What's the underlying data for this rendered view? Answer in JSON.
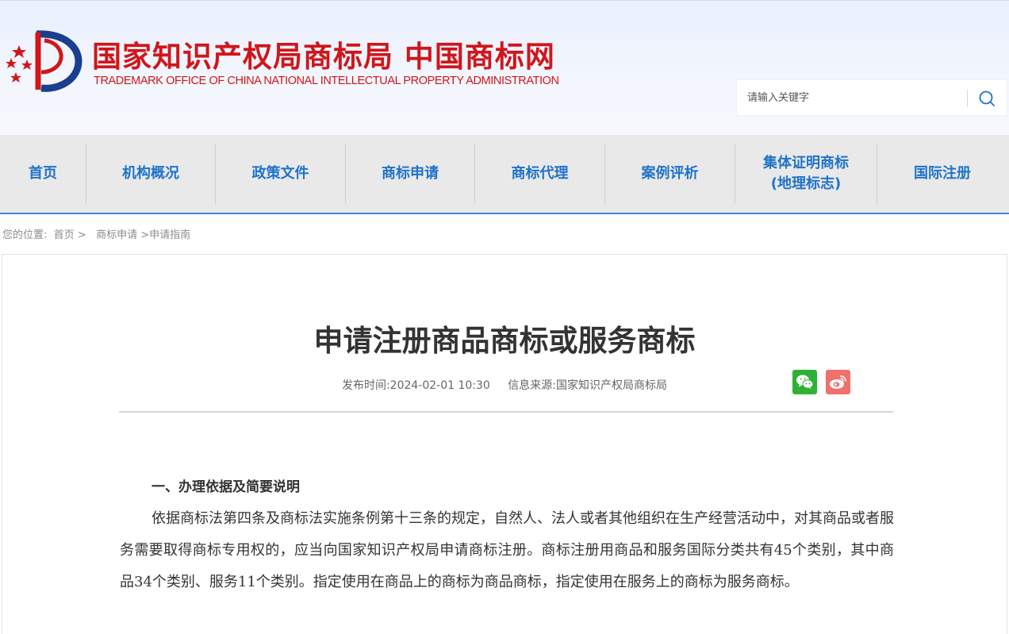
{
  "header": {
    "title": "国家知识产权局商标局 中国商标网",
    "subtitle": "TRADEMARK OFFICE OF CHINA NATIONAL INTELLECTUAL PROPERTY ADMINISTRATION",
    "search_placeholder": "请输入关键字"
  },
  "nav": {
    "items": [
      {
        "label": "首页"
      },
      {
        "label": "机构概况"
      },
      {
        "label": "政策文件"
      },
      {
        "label": "商标申请"
      },
      {
        "label": "商标代理"
      },
      {
        "label": "案例评析"
      },
      {
        "line1": "集体证明商标",
        "line2": "(地理标志)"
      },
      {
        "label": "国际注册"
      }
    ]
  },
  "breadcrumb": {
    "prefix": "您的位置:",
    "home": "首页",
    "sep": ">",
    "level1": "商标申请",
    "level2": ">申请指南"
  },
  "article": {
    "title": "申请注册商品商标或服务商标",
    "publish_time": "发布时间:2024-02-01 10:30",
    "source": "信息来源:国家知识产权局商标局",
    "section_heading": "一、办理依据及简要说明",
    "paragraph": "依据商标法第四条及商标法实施条例第十三条的规定，自然人、法人或者其他组织在生产经营活动中，对其商品或者服务需要取得商标专用权的，应当向国家知识产权局申请商标注册。商标注册用商品和服务国际分类共有45个类别，其中商品34个类别、服务11个类别。指定使用在商品上的商标为商品商标，指定使用在服务上的商标为服务商标。"
  },
  "colors": {
    "brand_red": "#d0161b",
    "nav_blue": "#1f73c9",
    "wechat_green": "#2fb138",
    "weibo_red": "#f0706c"
  },
  "icons": {
    "search": "search-icon",
    "wechat": "wechat-icon",
    "weibo": "weibo-icon",
    "logo": "logo-emblem"
  }
}
